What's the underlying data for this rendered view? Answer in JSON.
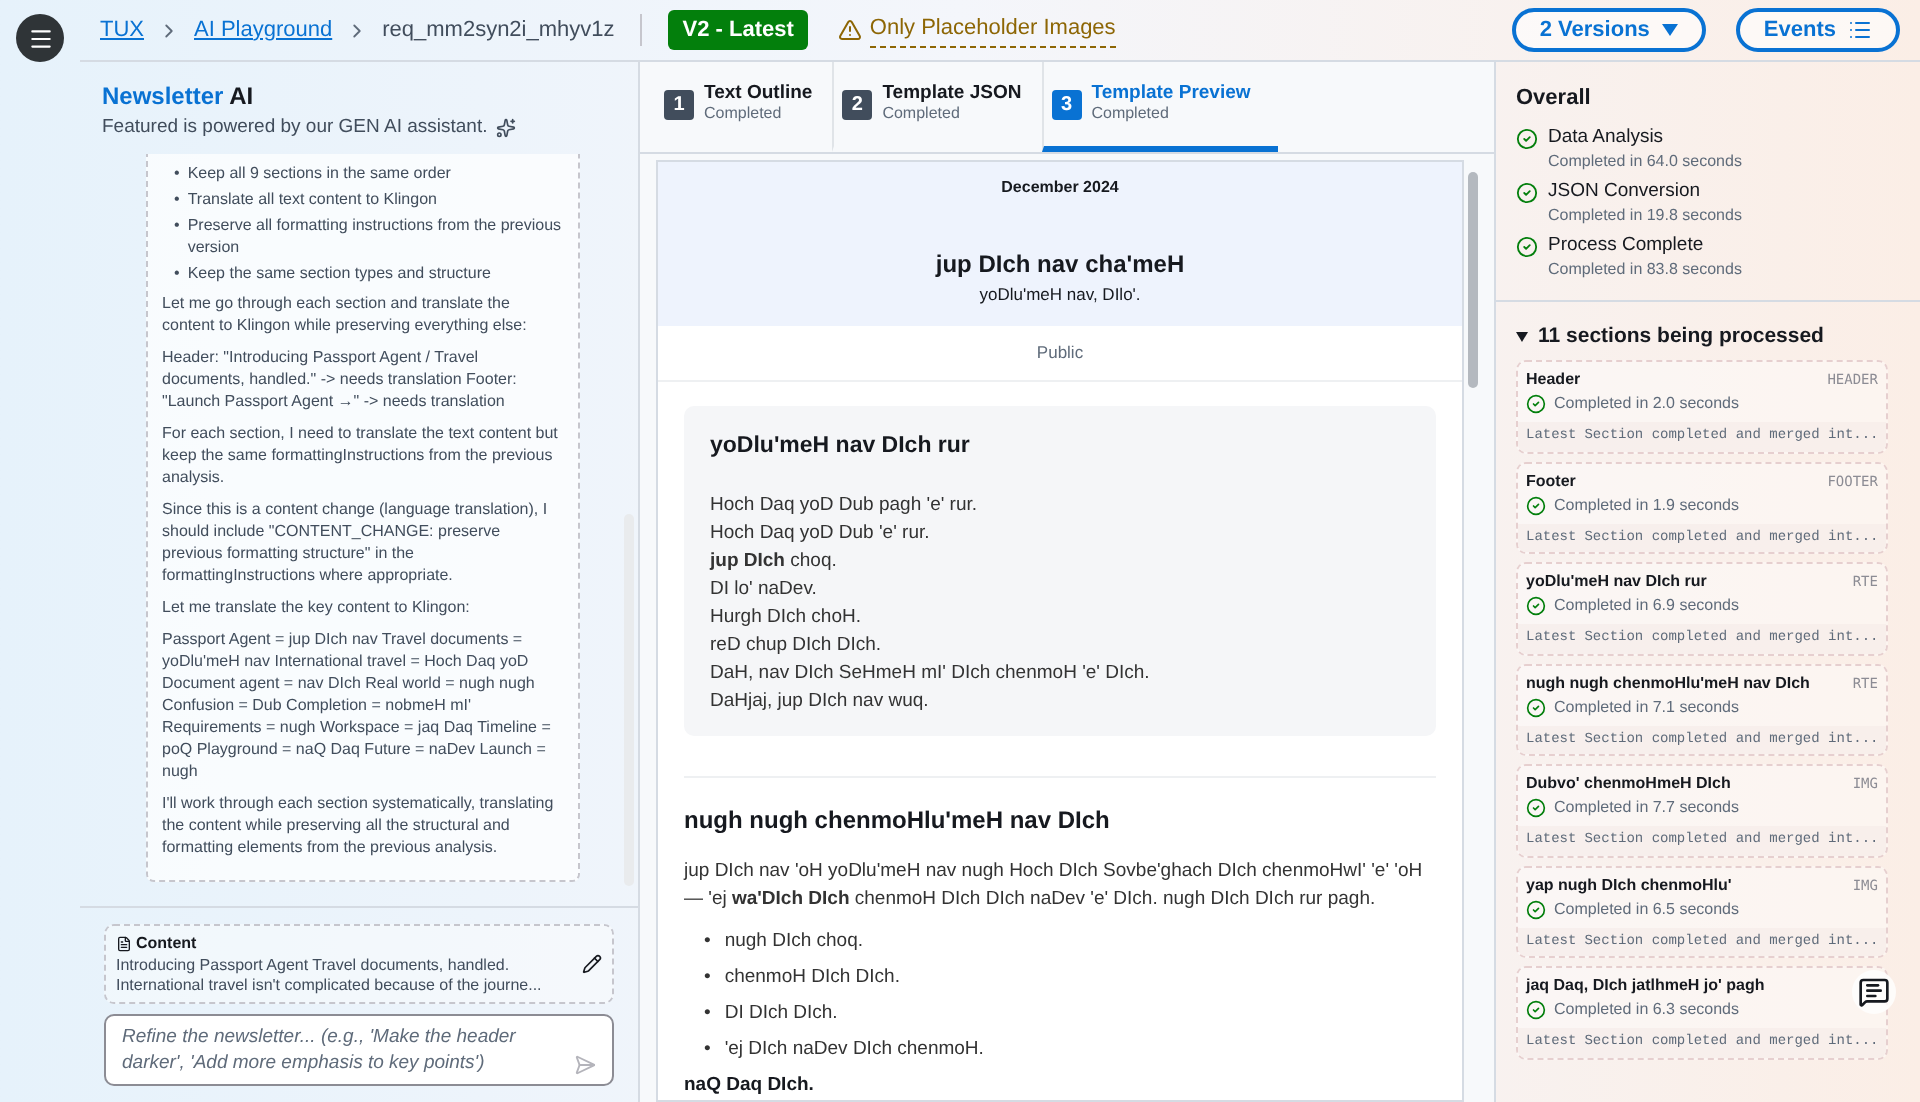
{
  "breadcrumb": {
    "items": [
      "TUX",
      "AI Playground"
    ],
    "current": "req_mm2syn2i_mhyv1z",
    "version_badge": "V2 - Latest",
    "warning": "Only Placeholder Images"
  },
  "header_buttons": [
    {
      "label": "2 Versions",
      "kind": "dropdown"
    },
    {
      "label": "Events",
      "kind": "list"
    }
  ],
  "assistant": {
    "title_part_1": "Newsletter",
    "title_part_2": "AI",
    "subtitle": "Featured is powered by our GEN AI assistant.",
    "bullet_marker": "•",
    "bullets": [
      "Keep all 9 sections in the same order",
      "Translate all text content to Klingon",
      "Preserve all formatting instructions from the previous version",
      "Keep the same section types and structure"
    ],
    "paragraphs": [
      "Let me go through each section and translate the content to Klingon while preserving everything else:",
      "Header: \"Introducing Passport Agent / Travel documents, handled.\" -> needs translation Footer: \"Launch Passport Agent →\" -> needs translation",
      "For each section, I need to translate the text content but keep the same formattingInstructions from the previous analysis.",
      "Since this is a content change (language translation), I should include \"CONTENT_CHANGE: preserve previous formatting structure\" in the formattingInstructions where appropriate.",
      "Let me translate the key content to Klingon:",
      "Passport Agent = jup DIch nav Travel documents = yoDlu'meH nav International travel = Hoch Daq yoD Document agent = nav DIch Real world = nugh nugh Confusion = Dub Completion = nobmeH mI' Requirements = nugh Workspace = jaq Daq Timeline = poQ Playground = naQ Daq Future = naDev Launch = nugh",
      "I'll work through each section systematically, translating the content while preserving all the structural and formatting elements from the previous analysis."
    ],
    "content_label": "Content",
    "content_preview": "Introducing Passport Agent Travel documents, handled. International travel isn't complicated because of the journe...",
    "input_placeholder": "Refine the newsletter... (e.g., 'Make the header darker', 'Add more emphasis to key points')"
  },
  "steps": [
    {
      "number": "1",
      "title": "Text Outline",
      "status": "Completed",
      "selected": false
    },
    {
      "number": "2",
      "title": "Template JSON",
      "status": "Completed",
      "selected": false
    },
    {
      "number": "3",
      "title": "Template Preview",
      "status": "Completed",
      "selected": true
    }
  ],
  "newsletter": {
    "date": "December 2024",
    "title": "jup DIch nav cha'meH",
    "subtitle": "yoDlu'meH nav, DIlo'.",
    "audience": "Public",
    "section_1": {
      "heading": "yoDlu'meH nav DIch rur",
      "lines": [
        "Hoch Daq yoD Dub pagh 'e' rur.",
        "Hoch Daq yoD Dub 'e' rur.",
        "**jup DIch** choq.",
        "DI lo' naDev.",
        "Hurgh DIch choH.",
        "reD chup DIch DIch.",
        "DaH, nav DIch SeHmeH mI' DIch chenmoH 'e' DIch.",
        "DaHjaj, jup DIch nav wuq."
      ]
    },
    "section_2": {
      "heading": "nugh nugh chenmoHlu'meH nav DIch",
      "paragraph": "jup DIch nav 'oH yoDlu'meH nav nugh Hoch DIch Sovbe'ghach DIch chenmoHwI' 'e' 'oH — 'ej **wa'DIch DIch** chenmoH DIch DIch naDev 'e' DIch. nugh DIch DIch rur pagh.",
      "bullet_marker": "•",
      "bullets": [
        "nugh DIch choq.",
        "chenmoH DIch DIch.",
        "DI DIch DIch.",
        "'ej DIch naDev DIch chenmoH."
      ],
      "closing": "naQ Daq DIch."
    }
  },
  "overall": {
    "title": "Overall",
    "steps": [
      {
        "name": "Data Analysis",
        "detail": "Completed in 64.0 seconds",
        "done": true
      },
      {
        "name": "JSON Conversion",
        "detail": "Completed in 19.8 seconds",
        "done": true
      },
      {
        "name": "Process Complete",
        "detail": "Completed in 83.8 seconds",
        "done": true
      }
    ]
  },
  "sections": {
    "title": "11 sections being processed",
    "expanded": true,
    "items": [
      {
        "name": "Header",
        "type": "HEADER",
        "status": "Completed in 2.0 seconds",
        "latest_label": "Latest",
        "latest": "Section completed and merged int..."
      },
      {
        "name": "Footer",
        "type": "FOOTER",
        "status": "Completed in 1.9 seconds",
        "latest_label": "Latest",
        "latest": "Section completed and merged int..."
      },
      {
        "name": "yoDlu'meH nav DIch rur",
        "type": "RTE",
        "status": "Completed in 6.9 seconds",
        "latest_label": "Latest",
        "latest": "Section completed and merged int..."
      },
      {
        "name": "nugh nugh chenmoHlu'meH nav DIch",
        "type": "RTE",
        "status": "Completed in 7.1 seconds",
        "latest_label": "Latest",
        "latest": "Section completed and merged int..."
      },
      {
        "name": "Dubvo' chenmoHmeH DIch",
        "type": "IMG",
        "status": "Completed in 7.7 seconds",
        "latest_label": "Latest",
        "latest": "Section completed and merged int..."
      },
      {
        "name": "yap nugh DIch chenmoHlu'",
        "type": "IMG",
        "status": "Completed in 6.5 seconds",
        "latest_label": "Latest",
        "latest": "Section completed and merged int..."
      },
      {
        "name": "jaq Daq, DIch jatlhmeH jo' pagh",
        "status": "Completed in 6.3 seconds",
        "latest_label": "Latest",
        "latest": "Section completed and merged int..."
      }
    ]
  }
}
